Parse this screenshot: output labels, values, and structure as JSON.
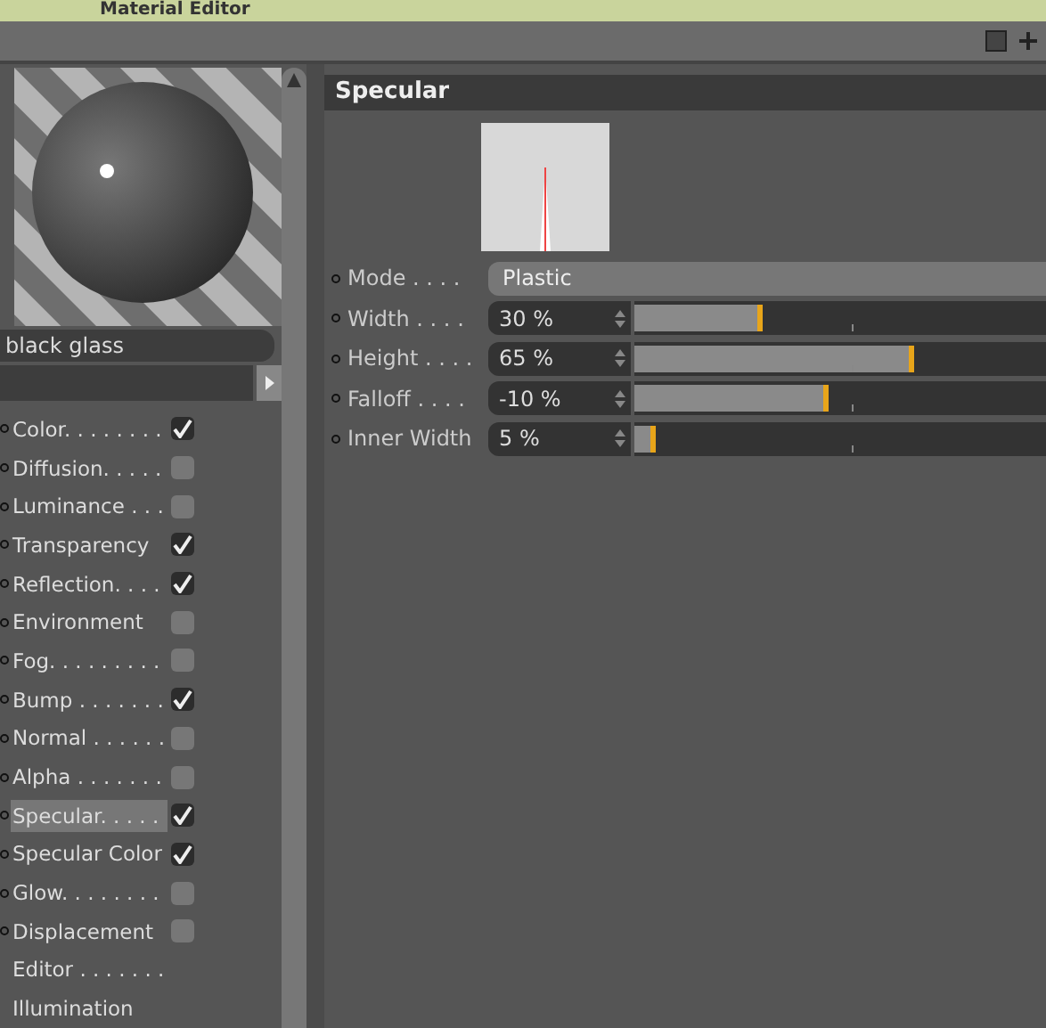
{
  "window": {
    "title": "Material Editor"
  },
  "material": {
    "name": "black glass"
  },
  "channels": [
    {
      "kind": "toggle",
      "label": "Color. . . . . . . .",
      "checked": true,
      "selected": false
    },
    {
      "kind": "toggle",
      "label": "Diffusion. . . . .",
      "checked": false,
      "selected": false
    },
    {
      "kind": "toggle",
      "label": "Luminance . . .",
      "checked": false,
      "selected": false
    },
    {
      "kind": "toggle",
      "label": "Transparency",
      "checked": true,
      "selected": false
    },
    {
      "kind": "toggle",
      "label": "Reflection. . . .",
      "checked": true,
      "selected": false
    },
    {
      "kind": "toggle",
      "label": "Environment",
      "checked": false,
      "selected": false
    },
    {
      "kind": "toggle",
      "label": "Fog. . . . . . . . .",
      "checked": false,
      "selected": false
    },
    {
      "kind": "toggle",
      "label": "Bump . . . . . . .",
      "checked": true,
      "selected": false
    },
    {
      "kind": "toggle",
      "label": "Normal . . . . . .",
      "checked": false,
      "selected": false
    },
    {
      "kind": "toggle",
      "label": "Alpha . . . . . . .",
      "checked": false,
      "selected": false
    },
    {
      "kind": "toggle",
      "label": "Specular. . . . .",
      "checked": true,
      "selected": true
    },
    {
      "kind": "toggle",
      "label": "Specular Color",
      "checked": true,
      "selected": false
    },
    {
      "kind": "toggle",
      "label": "Glow. . . . . . . .",
      "checked": false,
      "selected": false
    },
    {
      "kind": "toggle",
      "label": "Displacement",
      "checked": false,
      "selected": false
    },
    {
      "kind": "plain",
      "label": "Editor . . . . . . .",
      "selected": false
    },
    {
      "kind": "plain",
      "label": "Illumination",
      "selected": false
    }
  ],
  "panel": {
    "title": "Specular",
    "mode": {
      "label": "Mode . . . .",
      "value": "Plastic"
    },
    "params": [
      {
        "label": "Width . . . .",
        "value": "30 %",
        "level": 0.31
      },
      {
        "label": "Height . . . .",
        "value": "65 %",
        "level": 0.68
      },
      {
        "label": "Falloff . . . .",
        "value": "-10 %",
        "level": 0.47
      },
      {
        "label": "Inner Width",
        "value": "5 %",
        "level": 0.05
      }
    ]
  }
}
